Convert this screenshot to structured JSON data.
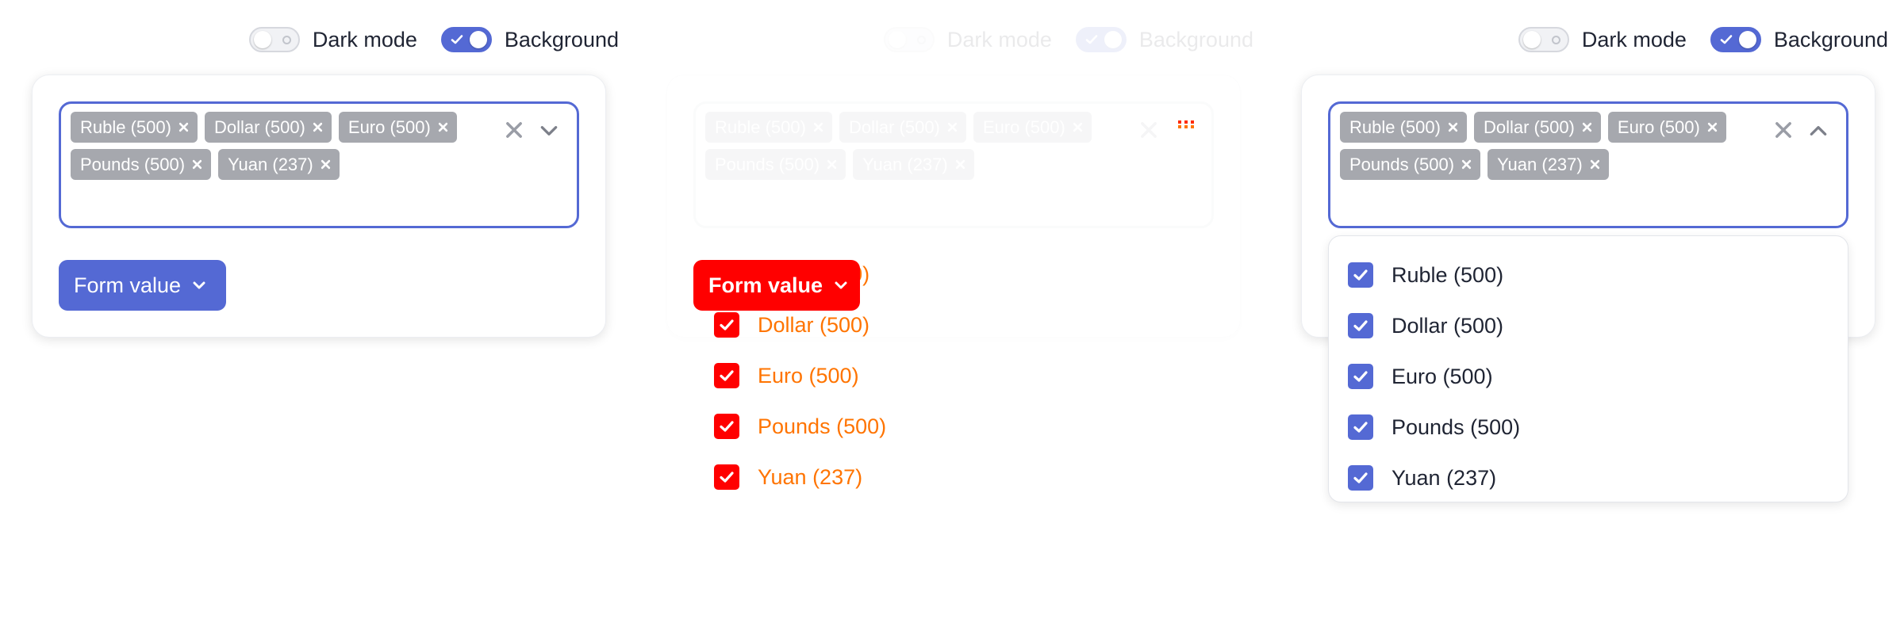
{
  "toggles": {
    "dark_mode_label": "Dark mode",
    "background_label": "Background",
    "dark_mode_on": false,
    "background_on": true
  },
  "tags": [
    {
      "label": "Ruble (500)"
    },
    {
      "label": "Dollar (500)"
    },
    {
      "label": "Euro (500)"
    },
    {
      "label": "Pounds (500)"
    },
    {
      "label": "Yuan (237)"
    }
  ],
  "options": [
    {
      "label": "Ruble (500)",
      "checked": true
    },
    {
      "label": "Dollar (500)",
      "checked": true
    },
    {
      "label": "Euro (500)",
      "checked": true
    },
    {
      "label": "Pounds (500)",
      "checked": true
    },
    {
      "label": "Yuan (237)",
      "checked": true
    }
  ],
  "form_button": {
    "label": "Form value"
  },
  "colors": {
    "accent": "#5469d4",
    "tag_bg": "#a6a8ae",
    "debug_red": "#ff0000",
    "debug_orange": "#ff7400",
    "text": "#1f2433"
  },
  "icons": {
    "clear": "close-icon",
    "collapsed": "chevron-down-icon",
    "expanded": "chevron-up-icon",
    "loading": "dots-icon",
    "tag_remove": "close-icon",
    "check": "check-icon"
  }
}
